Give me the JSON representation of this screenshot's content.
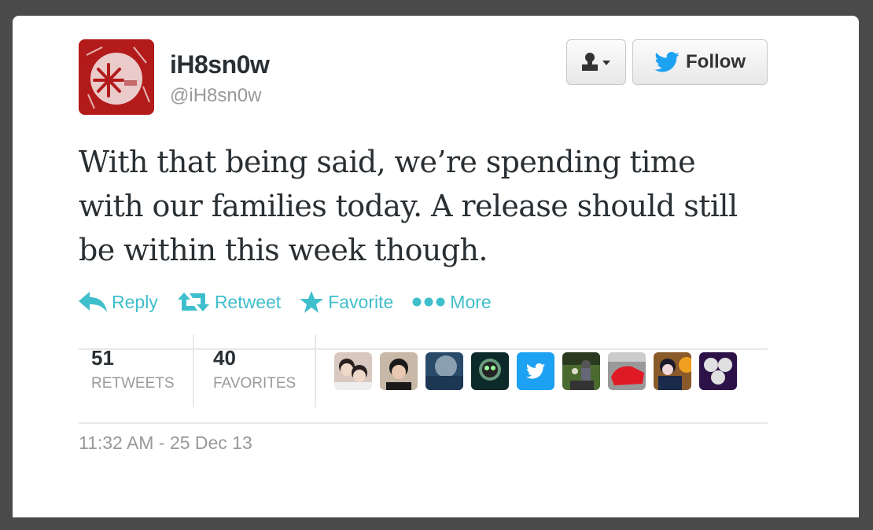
{
  "user": {
    "display_name": "iH8sn0w",
    "handle": "@iH8sn0w",
    "avatar_icon": "snowflake-logo-icon"
  },
  "buttons": {
    "user_actions_icon": "user-dropdown-icon",
    "follow_label": "Follow",
    "follow_icon": "twitter-bird-icon"
  },
  "tweet": {
    "text": "With that being said, we’re spending time with our families today. A release should still be within this week though."
  },
  "actions": [
    {
      "label": "Reply",
      "icon": "reply-icon"
    },
    {
      "label": "Retweet",
      "icon": "retweet-icon"
    },
    {
      "label": "Favorite",
      "icon": "star-icon"
    },
    {
      "label": "More",
      "icon": "more-dots-icon"
    }
  ],
  "stats": {
    "retweets": {
      "count": "51",
      "label": "RETWEETS"
    },
    "favorites": {
      "count": "40",
      "label": "FAVORITES"
    }
  },
  "favoriters": [
    {
      "name": "favoriter-avatar-1"
    },
    {
      "name": "favoriter-avatar-2"
    },
    {
      "name": "favoriter-avatar-3"
    },
    {
      "name": "favoriter-avatar-4"
    },
    {
      "name": "favoriter-avatar-5"
    },
    {
      "name": "favoriter-avatar-6"
    },
    {
      "name": "favoriter-avatar-7"
    },
    {
      "name": "favoriter-avatar-8"
    },
    {
      "name": "favoriter-avatar-9"
    }
  ],
  "timestamp": "11:32 AM - 25 Dec 13",
  "colors": {
    "accent": "#3fbfcb",
    "twitter_blue": "#1da1f2",
    "avatar_red": "#b31b1b",
    "text": "#292f33",
    "muted": "#999999"
  }
}
